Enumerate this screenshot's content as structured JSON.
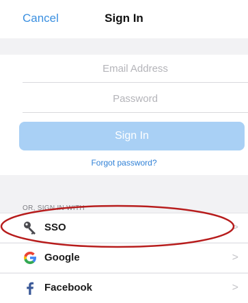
{
  "nav": {
    "cancel_label": "Cancel",
    "title": "Sign In"
  },
  "form": {
    "email_placeholder": "Email Address",
    "password_placeholder": "Password",
    "signin_label": "Sign In",
    "forgot_label": "Forgot password?"
  },
  "social": {
    "section_label": "OR, SIGN IN WITH",
    "items": [
      {
        "label": "SSO",
        "icon": "key-icon"
      },
      {
        "label": "Google",
        "icon": "google-icon"
      },
      {
        "label": "Facebook",
        "icon": "facebook-icon"
      }
    ]
  },
  "colors": {
    "accent": "#3a8fe0",
    "button_disabled": "#a9d0f5",
    "annotation": "#b71c1c"
  }
}
